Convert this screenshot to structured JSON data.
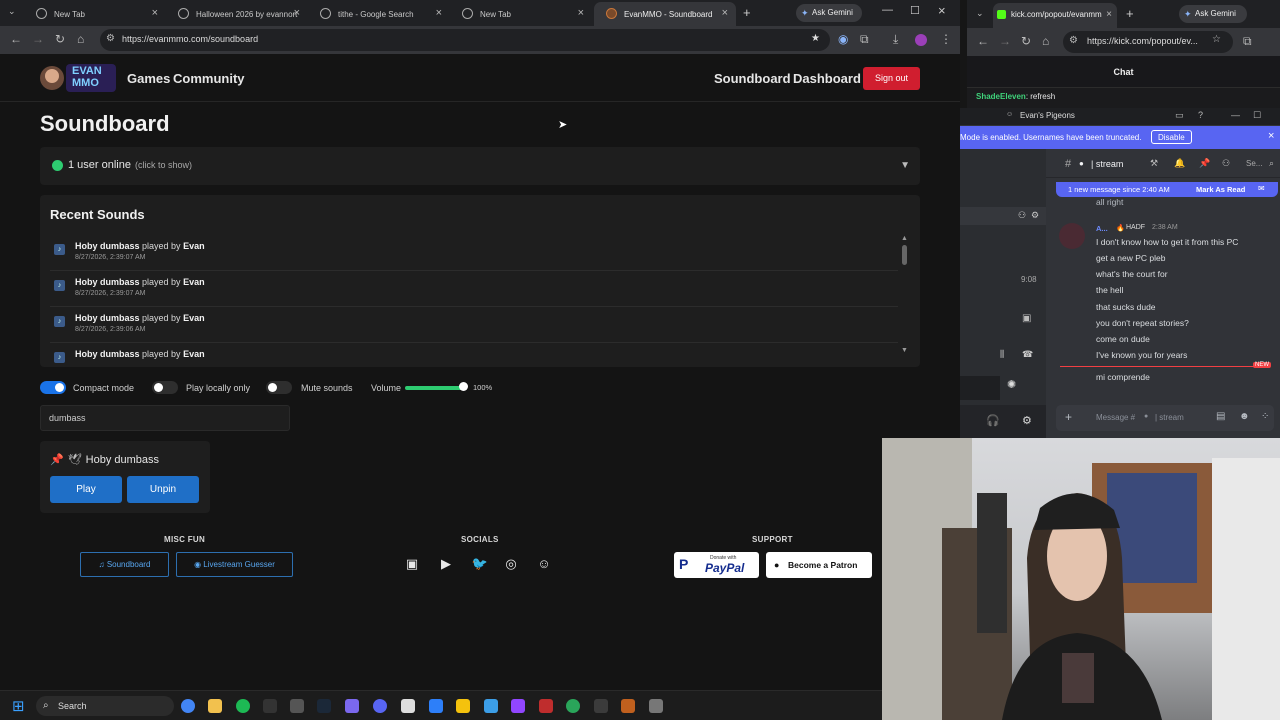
{
  "left_browser": {
    "tabs": [
      {
        "label": "New Tab"
      },
      {
        "label": "Halloween 2026 by evannort"
      },
      {
        "label": "tithe - Google Search"
      },
      {
        "label": "New Tab"
      },
      {
        "label": "EvanMMO - Soundboard"
      }
    ],
    "ask_gemini": "Ask Gemini",
    "url": "https://evanmmo.com/soundboard"
  },
  "site": {
    "logo_text": "EVAN MMO",
    "nav_left": [
      "Games",
      "Community"
    ],
    "nav_right": [
      "Soundboard",
      "Dashboard"
    ],
    "signout_label": "Sign out",
    "page_title": "Soundboard",
    "online": {
      "text": "1 user online",
      "hint": "(click to show)"
    },
    "recent_title": "Recent Sounds",
    "recent": [
      {
        "sound": "Hoby dumbass",
        "played_by": "played by",
        "user": "Evan",
        "time": "8/27/2026, 2:39:07 AM"
      },
      {
        "sound": "Hoby dumbass",
        "played_by": "played by",
        "user": "Evan",
        "time": "8/27/2026, 2:39:07 AM"
      },
      {
        "sound": "Hoby dumbass",
        "played_by": "played by",
        "user": "Evan",
        "time": "8/27/2026, 2:39:06 AM"
      },
      {
        "sound": "Hoby dumbass",
        "played_by": "played by",
        "user": "Evan",
        "time": ""
      }
    ],
    "controls": {
      "compact": {
        "label": "Compact mode",
        "on": true
      },
      "local": {
        "label": "Play locally only",
        "on": false
      },
      "mute": {
        "label": "Mute sounds",
        "on": false
      },
      "volume_label": "Volume",
      "volume_value": "100%",
      "volume_level": 1.0
    },
    "search_value": "dumbass",
    "card": {
      "title": "Hoby dumbass",
      "play_label": "Play",
      "unpin_label": "Unpin"
    },
    "footer": {
      "misc_head": "MISC FUN",
      "socials_head": "SOCIALS",
      "support_head": "SUPPORT",
      "misc_buttons": [
        "Soundboard",
        "Livestream Guesser"
      ],
      "paypal_small": "Donate with",
      "paypal_big": "PayPal",
      "patron_label": "Become a Patron"
    }
  },
  "right_browser": {
    "tab_label": "kick.com/popout/evanmm",
    "ask_gemini": "Ask Gemini",
    "url": "https://kick.com/popout/ev...",
    "chat_header": "Chat",
    "chat_user": "ShadeEleven",
    "chat_text": ": refresh"
  },
  "discord": {
    "server": "Evan's Pigeons",
    "banner_text": "Mode is enabled. Usernames have been truncated.",
    "banner_button": "Disable",
    "channel": "| stream",
    "search_placeholder": "Se...",
    "new_messages": "1 new message since 2:40 AM",
    "mark_read": "Mark As Read",
    "partial_top": "all right",
    "author": "A...",
    "author_tag": "HADF",
    "author_time": "2:38 AM",
    "timestamp_side": "9:08",
    "messages": [
      "I don't know how to get it from this PC",
      "get a new PC pleb",
      "what's the court for",
      "the hell",
      "that sucks dude",
      "you don't repeat stories?",
      "come on dude",
      "I've known you for years"
    ],
    "new_label": "NEW",
    "last_message": "mi comprende",
    "input_placeholder": "Message #",
    "input_channel": "| stream"
  },
  "taskbar": {
    "search": "Search"
  },
  "colors": {
    "accent_blue": "#1f6fc7",
    "signout_red": "#d01e2f",
    "online_green": "#2ecc71",
    "discord_blurple": "#5865f2"
  }
}
